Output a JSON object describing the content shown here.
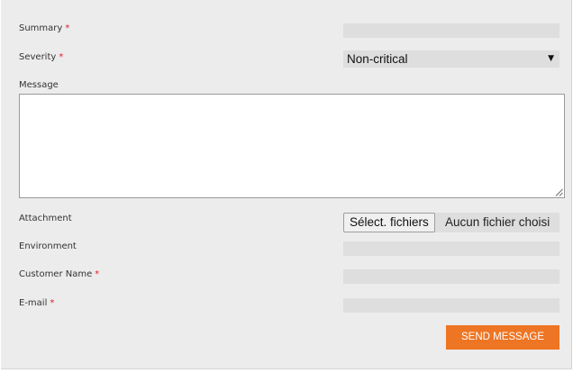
{
  "form": {
    "summary": {
      "label": "Summary",
      "required_mark": "*"
    },
    "severity": {
      "label": "Severity",
      "required_mark": "*",
      "selected": "Non-critical"
    },
    "message": {
      "label": "Message"
    },
    "attachment": {
      "label": "Attachment",
      "button_label": "Sélect. fichiers",
      "status": "Aucun fichier choisi"
    },
    "environment": {
      "label": "Environment"
    },
    "customer_name": {
      "label": "Customer Name",
      "required_mark": "*"
    },
    "email": {
      "label": "E-mail",
      "required_mark": "*"
    },
    "submit_label": "SEND MESSAGE"
  },
  "icons": {
    "select_caret": "chevron-down-icon",
    "textarea_grip": "resize-grip-icon"
  },
  "colors": {
    "panel_background": "#ececec",
    "field_background": "#dedede",
    "required": "#d9232d",
    "submit_button": "#ee7523"
  }
}
